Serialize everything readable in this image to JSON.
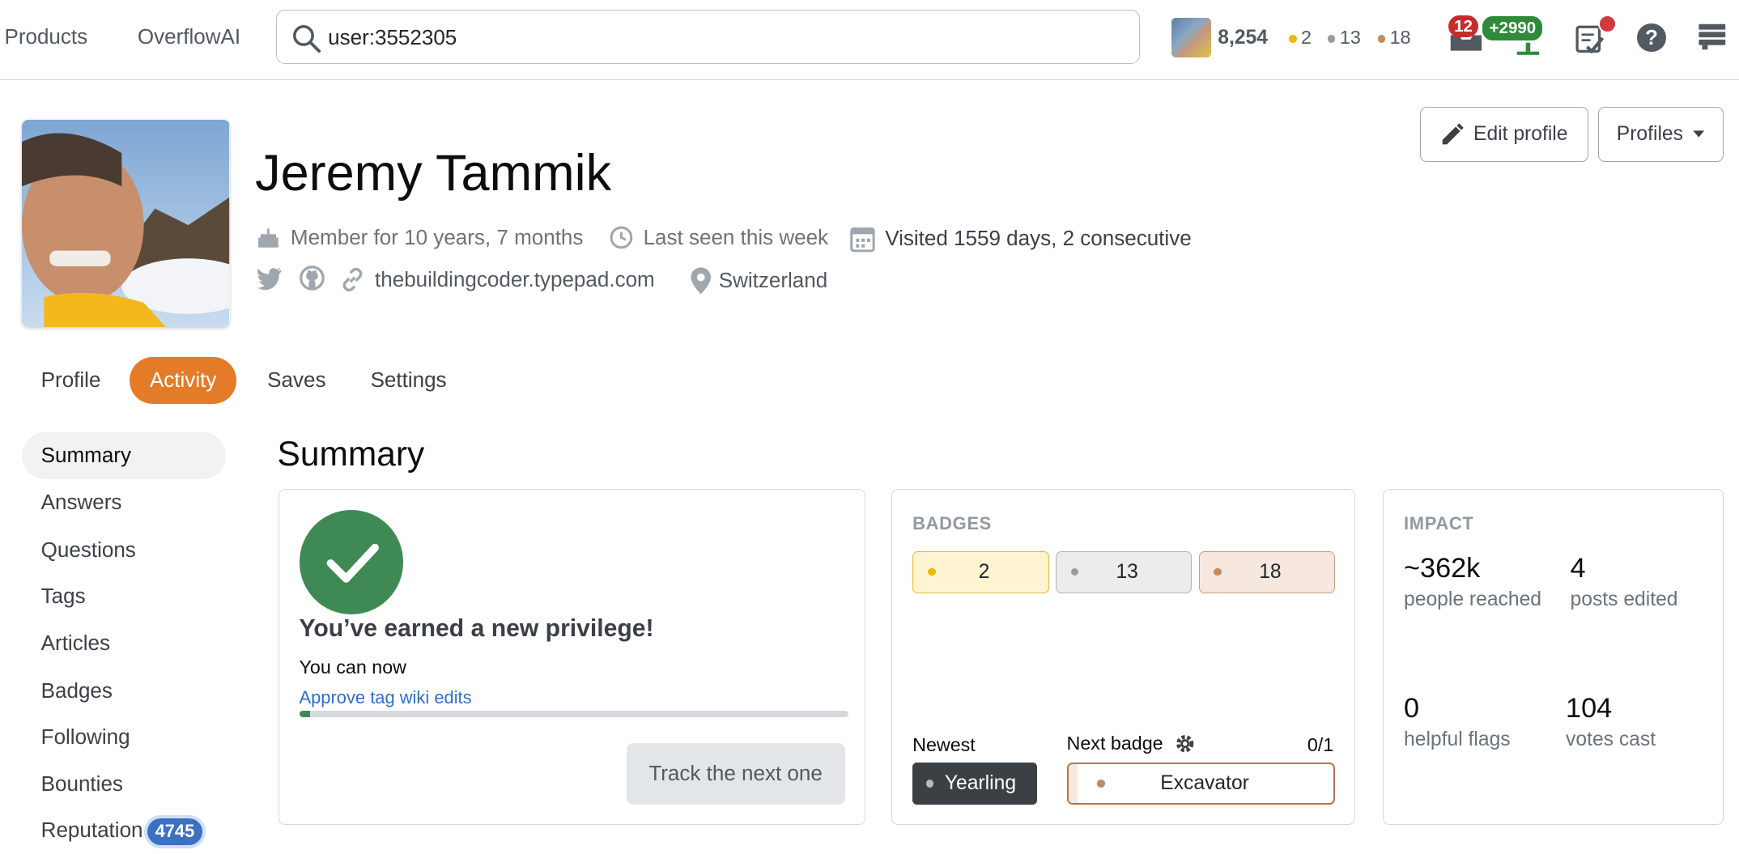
{
  "topbar": {
    "nav": [
      "Products",
      "OverflowAI"
    ],
    "search_value": "user:3552305",
    "reputation": "8,254",
    "gold": "2",
    "silver": "13",
    "bronze": "18",
    "inbox_count": "12",
    "achievements_count": "+2990"
  },
  "profile": {
    "name": "Jeremy Tammik",
    "member_for": "Member for 10 years, 7 months",
    "last_seen": "Last seen this week",
    "visited": "Visited 1559 days, 2 consecutive",
    "website": "thebuildingcoder.typepad.com",
    "location": "Switzerland",
    "edit_profile": "Edit profile",
    "profiles": "Profiles"
  },
  "tabs": [
    "Profile",
    "Activity",
    "Saves",
    "Settings"
  ],
  "sidebar": [
    {
      "label": "Summary"
    },
    {
      "label": "Answers"
    },
    {
      "label": "Questions"
    },
    {
      "label": "Tags"
    },
    {
      "label": "Articles"
    },
    {
      "label": "Badges"
    },
    {
      "label": "Following"
    },
    {
      "label": "Bounties"
    },
    {
      "label": "Reputation",
      "count": "4745"
    }
  ],
  "summary": {
    "heading": "Summary",
    "privilege": {
      "title": "You’ve earned a new privilege!",
      "you_can_now": "You can now",
      "link": "Approve tag wiki edits",
      "progress": 0.02,
      "button": "Track the next one"
    },
    "badges": {
      "title": "BADGES",
      "gold": "2",
      "silver": "13",
      "bronze": "18",
      "newest_label": "Newest",
      "newest": "Yearling",
      "next_label": "Next badge",
      "next_progress": "0/1",
      "next": "Excavator"
    },
    "impact": {
      "title": "IMPACT",
      "reached": "~362k",
      "reached_label": "people reached",
      "edited": "4",
      "edited_label": "posts edited",
      "flags": "0",
      "flags_label": "helpful flags",
      "votes": "104",
      "votes_label": "votes cast"
    }
  },
  "colors": {
    "accent": "#e37b28",
    "gold": "#f1b600",
    "silver": "#9a9b9e",
    "bronze": "#c38b5f",
    "privilege_green": "#3f8a54",
    "link": "#2e6fcb"
  }
}
